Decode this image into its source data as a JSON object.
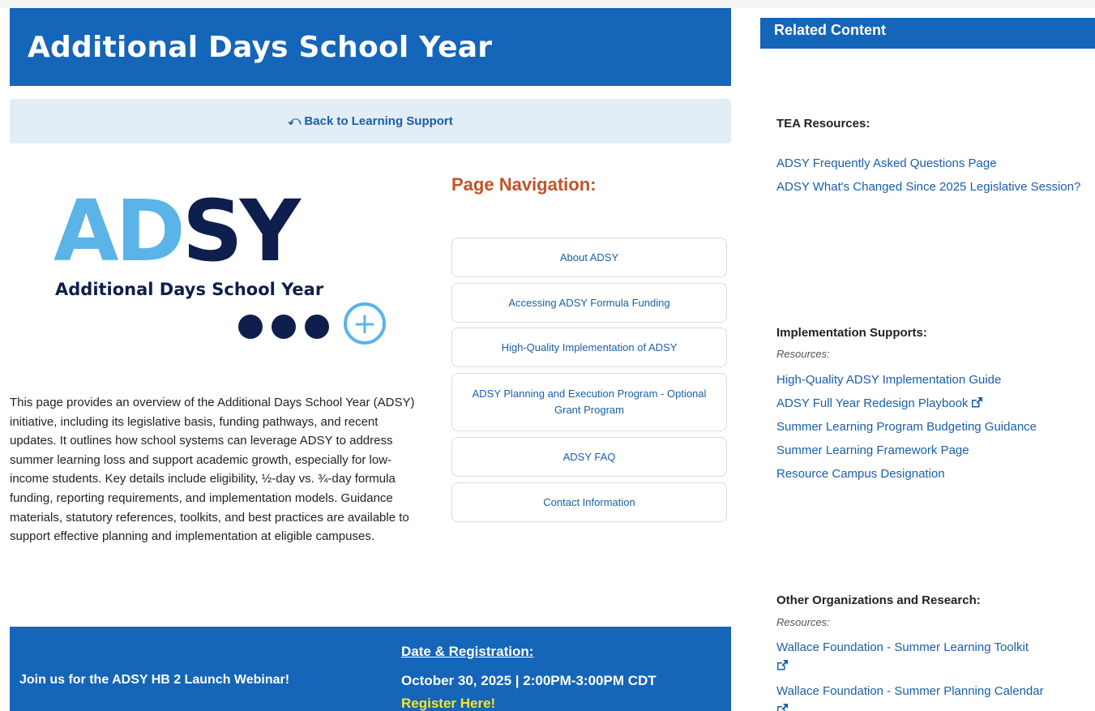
{
  "main": {
    "title": "Additional Days School Year",
    "back_link": "⤺ Back to Learning Support",
    "logo": {
      "letters_light": "AD",
      "letters_dark": "SY",
      "tagline": "Additional Days School Year",
      "plus": "+"
    },
    "intro": "This page provides an overview of the Additional Days School Year (ADSY) initiative, including its legislative basis, funding pathways, and recent updates. It outlines how school systems can leverage ADSY to address summer learning loss and support academic growth, especially for low-income students. Key details include eligibility, ½-day vs. ¾-day formula funding, reporting requirements, and implementation models. Guidance materials, statutory references, toolkits, and best practices are available to support effective planning and implementation at eligible campuses."
  },
  "page_nav": {
    "heading": "Page Navigation:",
    "items": [
      {
        "label": "About ADSY"
      },
      {
        "label": "Accessing ADSY Formula Funding"
      },
      {
        "label": "High-Quality Implementation of ADSY"
      },
      {
        "label": "ADSY Planning and Execution Program - Optional Grant Program"
      },
      {
        "label": "ADSY FAQ"
      },
      {
        "label": "Contact Information"
      }
    ]
  },
  "webinar": {
    "invite": "Join us for the ADSY HB 2 Launch Webinar!",
    "date_heading": "Date & Registration:",
    "date": "October 30, 2025 | 2:00PM-3:00PM CDT",
    "register": "Register Here!"
  },
  "related": {
    "title": "Related Content",
    "sections": [
      {
        "heading": "TEA Resources:",
        "links": [
          {
            "label": "ADSY Frequently Asked Questions Page"
          },
          {
            "label": "ADSY What's Changed Since 2025 Legislative Session?"
          }
        ]
      },
      {
        "heading": "Implementation Supports:",
        "sub": "Resources:",
        "links": [
          {
            "label": "High-Quality ADSY Implementation Guide"
          },
          {
            "label": "ADSY Full Year Redesign Playbook",
            "external": true
          },
          {
            "label": "Summer Learning Program Budgeting Guidance"
          },
          {
            "label": "Summer Learning Framework Page"
          },
          {
            "label": "Resource Campus Designation"
          }
        ]
      },
      {
        "heading": "Other Organizations and Research:",
        "sub": "Resources:",
        "links": [
          {
            "label": "Wallace Foundation - Summer Learning Toolkit",
            "external": true
          },
          {
            "label": "Wallace Foundation - Summer Planning Calendar",
            "external": true
          }
        ]
      }
    ]
  },
  "colors": {
    "brand_blue": "#1565b8",
    "logo_light_blue": "#5ab4e8",
    "logo_navy": "#0e1f4d",
    "nav_heading": "#c0532c",
    "link": "#1a5fa8",
    "register": "#f5e52a"
  }
}
